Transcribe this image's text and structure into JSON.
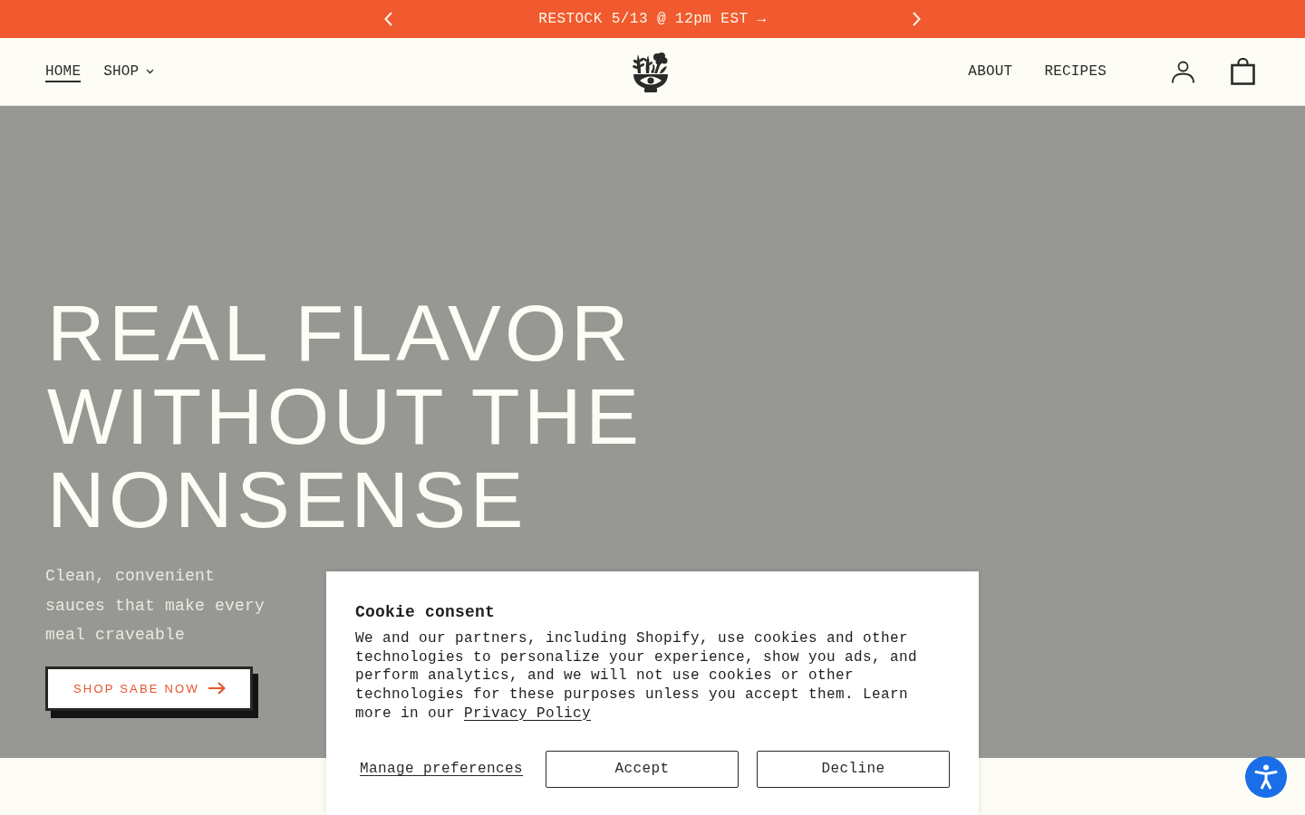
{
  "announcement_bar": {
    "message": "RESTOCK 5/13 @ 12pm EST →"
  },
  "header": {
    "nav_left": [
      {
        "label": "HOME",
        "selected": true,
        "kind": "link"
      },
      {
        "label": "SHOP",
        "selected": false,
        "kind": "dropdown"
      }
    ],
    "nav_right": [
      {
        "label": "ABOUT",
        "selected": false
      },
      {
        "label": "RECIPES",
        "selected": false
      }
    ]
  },
  "hero": {
    "heading": "REAL FLAVOR WITHOUT THE NONSENSE",
    "subtitle": "Clean, convenient sauces that make every meal craveable",
    "cta": "SHOP SABE NOW"
  },
  "cookie_banner": {
    "title": "Cookie consent",
    "text": "We and our partners, including Shopify, use cookies and other technologies to personalize your experience, show you ads, and perform analytics, and we will not use cookies or other technologies for these purposes unless you accept them. Learn more in our",
    "link": "Privacy Policy",
    "buttons": [
      {
        "label": "Manage preferences",
        "kind": "link"
      },
      {
        "label": "Accept",
        "kind": "outlined"
      },
      {
        "label": "Decline",
        "kind": "outlined"
      }
    ]
  }
}
